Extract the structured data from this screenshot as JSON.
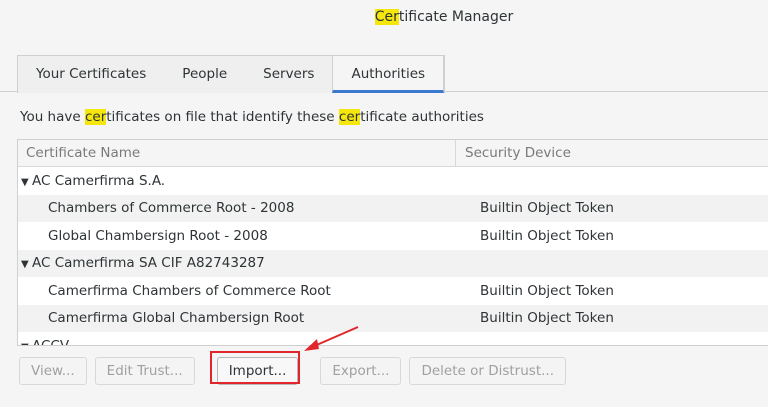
{
  "window": {
    "title_hl": "Cer",
    "title_rest": "tificate Manager"
  },
  "tabs": [
    {
      "label": "Your Certificates"
    },
    {
      "label": "People"
    },
    {
      "label": "Servers"
    },
    {
      "label": "Authorities",
      "active": true
    }
  ],
  "description": {
    "p1": "You have ",
    "h1": "cer",
    "p2": "tificates on file that identify these ",
    "h2": "cer",
    "p3": "tificate authorities"
  },
  "tree": {
    "col_name": "Certificate Name",
    "col_device": "Security Device",
    "rows": [
      {
        "type": "group",
        "name": "AC Camerfirma S.A.",
        "device": ""
      },
      {
        "type": "child",
        "name": "Chambers of Commerce Root - 2008",
        "device": "Builtin Object Token"
      },
      {
        "type": "child",
        "name": "Global Chambersign Root - 2008",
        "device": "Builtin Object Token"
      },
      {
        "type": "group",
        "name": "AC Camerfirma SA CIF A82743287",
        "device": ""
      },
      {
        "type": "child",
        "name": "Camerfirma Chambers of Commerce Root",
        "device": "Builtin Object Token"
      },
      {
        "type": "child",
        "name": "Camerfirma Global Chambersign Root",
        "device": "Builtin Object Token"
      },
      {
        "type": "group",
        "name": "ACCV",
        "device": ""
      }
    ]
  },
  "buttons": {
    "view": "View...",
    "edit_trust": "Edit Trust...",
    "import": "Import...",
    "export": "Export...",
    "delete": "Delete or Distrust..."
  },
  "colors": {
    "highlight": "#f5e60c",
    "annotation": "#e0262b",
    "tab_accent": "#3b7ad0"
  }
}
